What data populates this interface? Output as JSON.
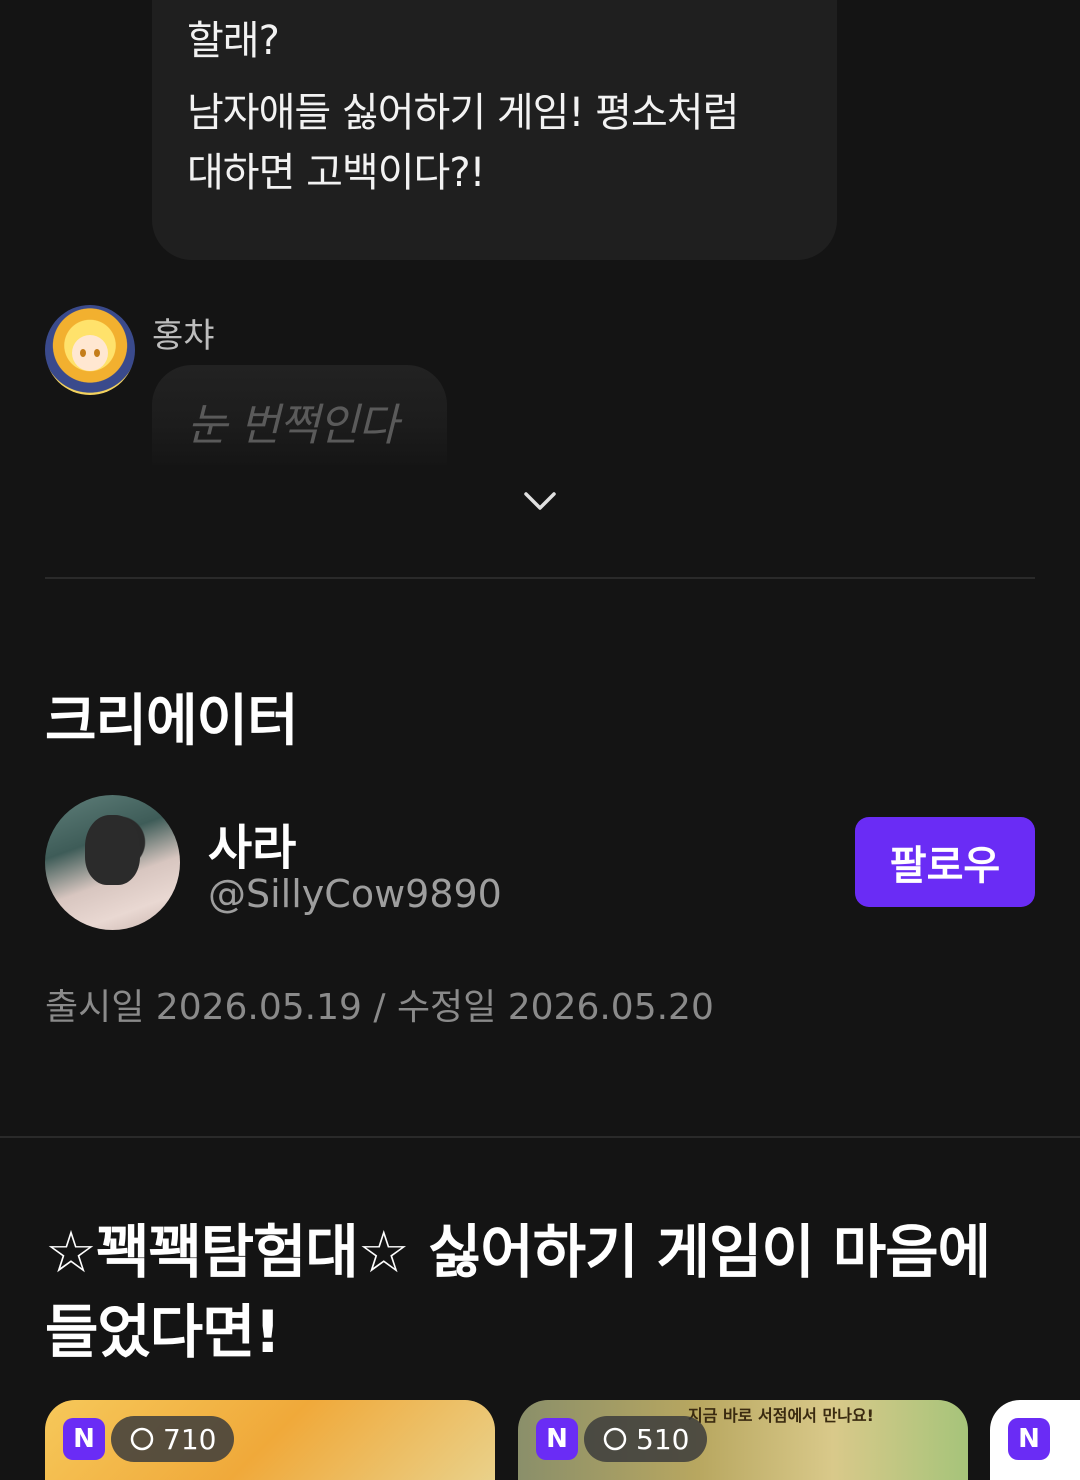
{
  "chat": {
    "top_bubble": {
      "line1": "할래?",
      "line2": "남자애들 싫어하기 게임! 평소처럼",
      "line3": "대하면 고백이다?!"
    },
    "reply": {
      "sender": "홍챠",
      "text": "눈 번쩍인다"
    }
  },
  "creator_section": {
    "title": "크리에이터",
    "name": "사라",
    "handle": "@SillyCow9890",
    "follow_label": "팔로우",
    "dates": "출시일 2026.05.19 / 수정일 2026.05.20"
  },
  "promo": {
    "title": "☆꽥꽥탐험대☆ 싫어하기 게임이 마음에 들었다면!"
  },
  "cards": [
    {
      "badge": "N",
      "stat": "710"
    },
    {
      "badge": "N",
      "stat": "510",
      "banner": "지금 바로 서점에서 만나요!"
    },
    {
      "badge": "N"
    }
  ],
  "colors": {
    "background": "#141414",
    "bubble": "#1f1f1f",
    "accent": "#6a2cf5"
  },
  "icons": {
    "expand": "chevron-down-icon",
    "stat": "eye-icon"
  }
}
